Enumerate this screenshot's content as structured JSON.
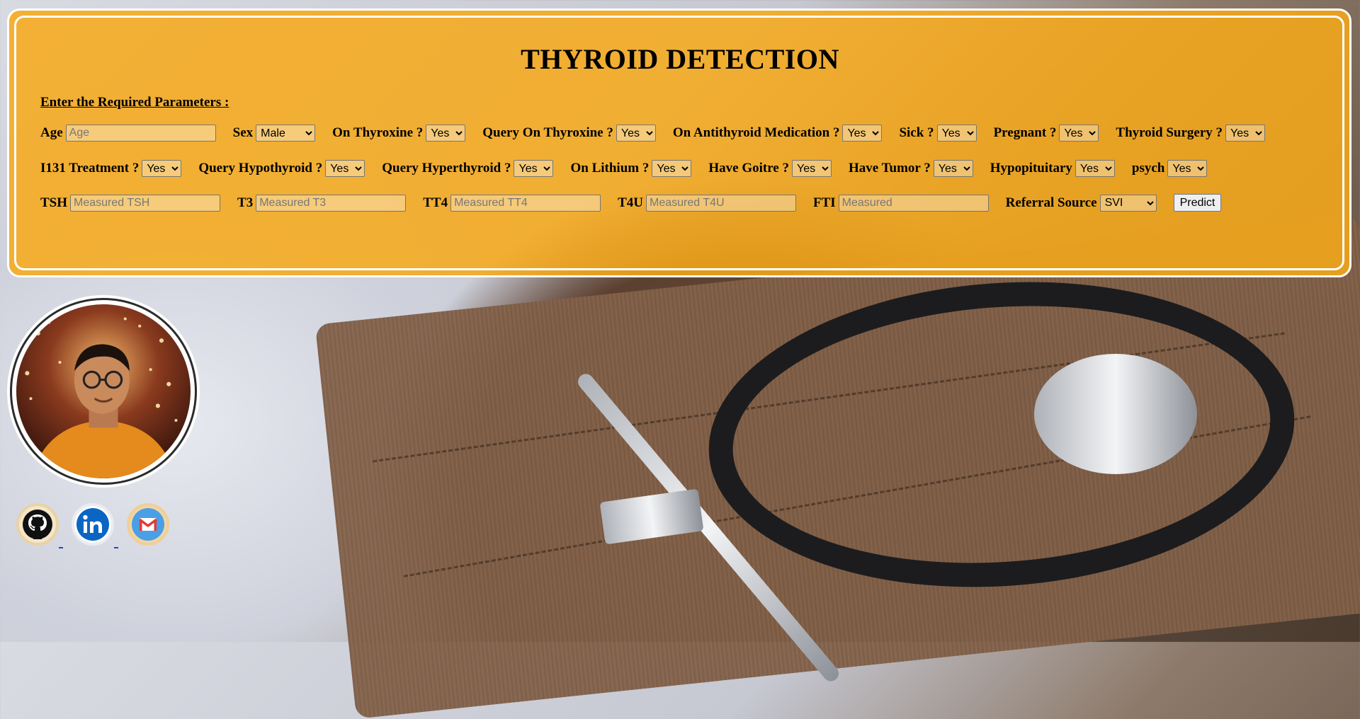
{
  "page": {
    "title": "THYROID DETECTION",
    "subheading": "Enter the Required Parameters :"
  },
  "form": {
    "age": {
      "label": "Age",
      "placeholder": "Age"
    },
    "sex": {
      "label": "Sex",
      "selected": "Male"
    },
    "on_thyroxine": {
      "label": "On Thyroxine ?",
      "selected": "Yes"
    },
    "query_on_thyroxine": {
      "label": "Query On Thyroxine ?",
      "selected": "Yes"
    },
    "on_antithyroid_medication": {
      "label": "On Antithyroid Medication ?",
      "selected": "Yes"
    },
    "sick": {
      "label": "Sick ?",
      "selected": "Yes"
    },
    "pregnant": {
      "label": "Pregnant ?",
      "selected": "Yes"
    },
    "thyroid_surgery": {
      "label": "Thyroid Surgery ?",
      "selected": "Yes"
    },
    "i131_treatment": {
      "label": "I131 Treatment ?",
      "selected": "Yes"
    },
    "query_hypothyroid": {
      "label": "Query Hypothyroid ?",
      "selected": "Yes"
    },
    "query_hyperthyroid": {
      "label": "Query Hyperthyroid ?",
      "selected": "Yes"
    },
    "on_lithium": {
      "label": "On Lithium ?",
      "selected": "Yes"
    },
    "have_goitre": {
      "label": "Have Goitre ?",
      "selected": "Yes"
    },
    "have_tumor": {
      "label": "Have Tumor ?",
      "selected": "Yes"
    },
    "hypopituitary": {
      "label": "Hypopituitary",
      "selected": "Yes"
    },
    "psych": {
      "label": "psych",
      "selected": "Yes"
    },
    "tsh": {
      "label": "TSH",
      "placeholder": "Measured TSH"
    },
    "t3": {
      "label": "T3",
      "placeholder": "Measured T3"
    },
    "tt4": {
      "label": "TT4",
      "placeholder": "Measured TT4"
    },
    "t4u": {
      "label": "T4U",
      "placeholder": "Measured T4U"
    },
    "fti": {
      "label": "FTI",
      "placeholder": "Measured"
    },
    "referral_source": {
      "label": "Referral Source",
      "selected": "SVI"
    },
    "predict_label": "Predict"
  },
  "profile": {
    "links": [
      {
        "icon": "github-icon"
      },
      {
        "icon": "linkedin-icon"
      },
      {
        "icon": "gmail-icon"
      }
    ]
  },
  "colors": {
    "panel": "#f7a919",
    "panel_border": "#ffffff"
  }
}
